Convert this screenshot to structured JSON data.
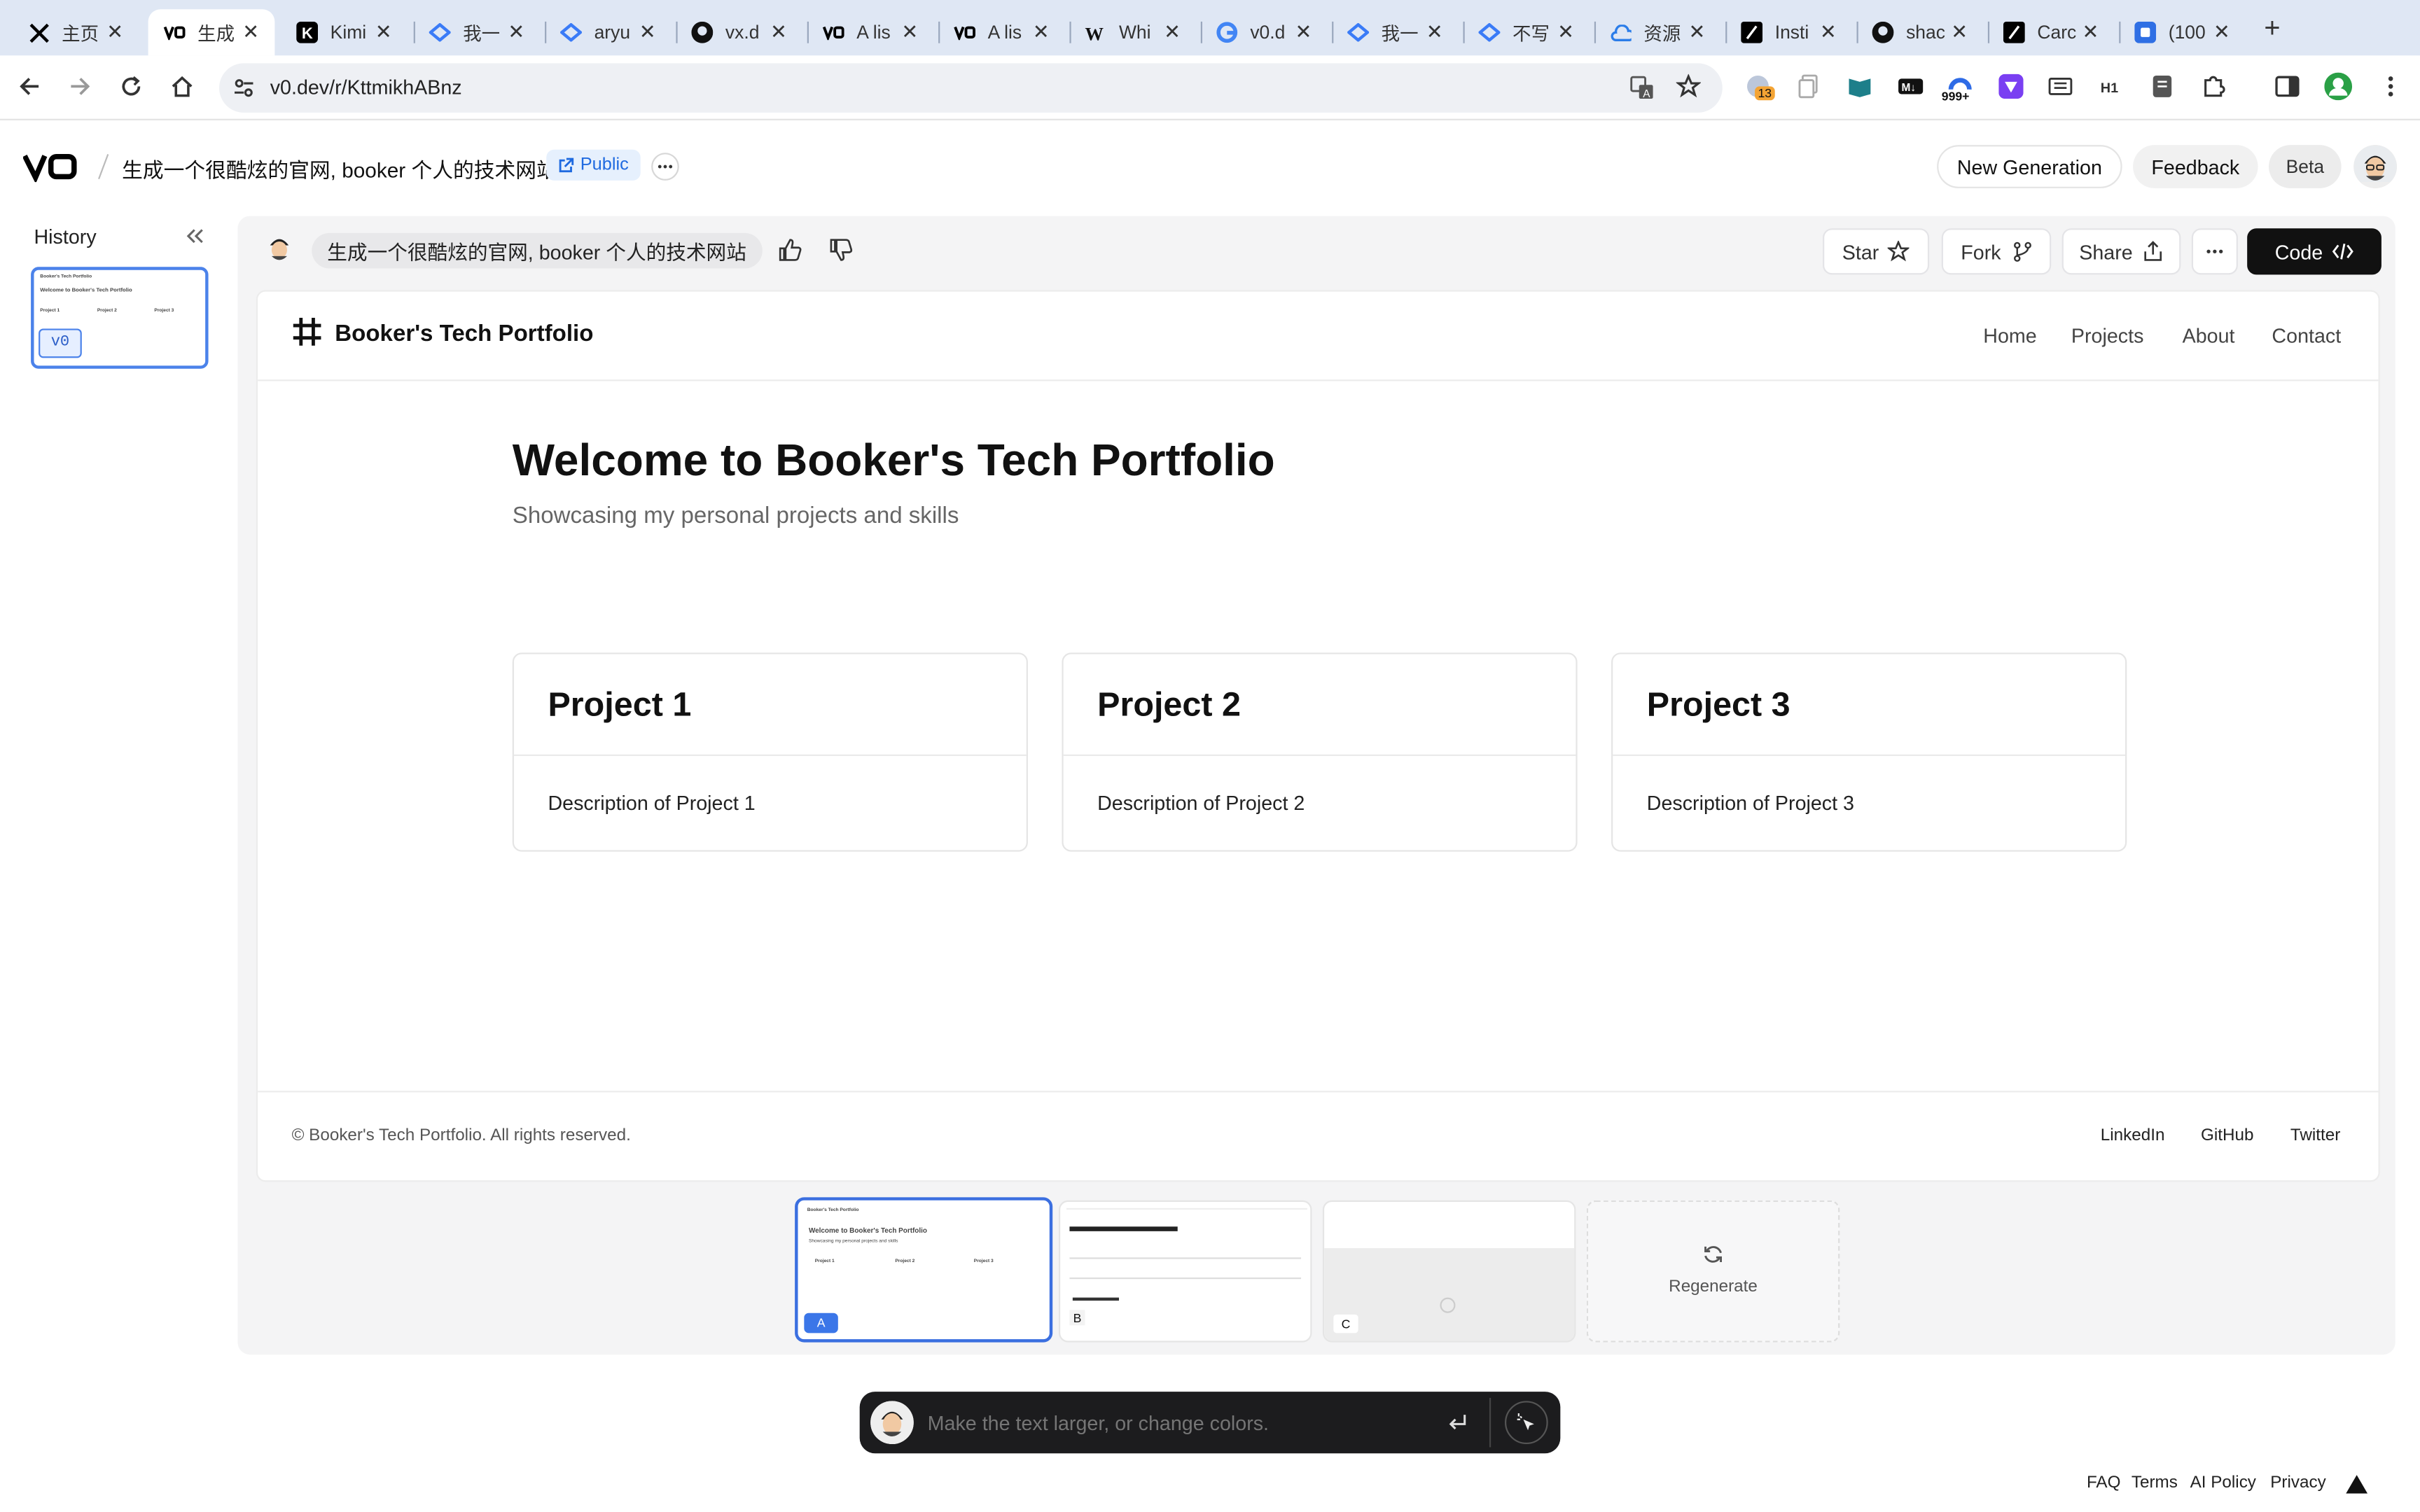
{
  "browser": {
    "tabs": [
      {
        "title": "主页",
        "icon": "x-logo-icon"
      },
      {
        "title": "生成",
        "icon": "v0-logo-icon",
        "active": true
      },
      {
        "title": "Kimi",
        "icon": "kimi-logo-icon"
      },
      {
        "title": "我一",
        "icon": "doc-logo-icon"
      },
      {
        "title": "aryu",
        "icon": "doc-logo-icon"
      },
      {
        "title": "vx.d",
        "icon": "github-icon"
      },
      {
        "title": "A lis",
        "icon": "v0-logo-icon"
      },
      {
        "title": "A lis",
        "icon": "v0-logo-icon"
      },
      {
        "title": "Whi",
        "icon": "w-logo-icon"
      },
      {
        "title": "v0.d",
        "icon": "google-icon"
      },
      {
        "title": "我一",
        "icon": "doc-logo-icon"
      },
      {
        "title": "不写",
        "icon": "doc-logo-icon"
      },
      {
        "title": "资源",
        "icon": "cloud-icon"
      },
      {
        "title": "Insti",
        "icon": "slash-logo-icon"
      },
      {
        "title": "shac",
        "icon": "github-icon"
      },
      {
        "title": "Carc",
        "icon": "slash-logo-icon"
      },
      {
        "title": "(100",
        "icon": "square-logo-icon"
      }
    ],
    "url": "v0.dev/r/KttmikhABnz",
    "badge_13": "13",
    "badge_999": "999+"
  },
  "header": {
    "title": "生成一个很酷炫的官网, booker 个人的技术网站",
    "visibility": "Public",
    "new_generation": "New Generation",
    "feedback": "Feedback",
    "beta": "Beta"
  },
  "sidebar": {
    "title": "History",
    "version": "v0"
  },
  "chat": {
    "prompt": "生成一个很酷炫的官网, booker 个人的技术网站",
    "star": "Star",
    "fork": "Fork",
    "share": "Share",
    "code": "Code"
  },
  "preview": {
    "brand": "Booker's Tech Portfolio",
    "nav": [
      "Home",
      "Projects",
      "About",
      "Contact"
    ],
    "heading": "Welcome to Booker's Tech Portfolio",
    "subheading": "Showcasing my personal projects and skills",
    "projects": [
      {
        "title": "Project 1",
        "desc": "Description of Project 1"
      },
      {
        "title": "Project 2",
        "desc": "Description of Project 2"
      },
      {
        "title": "Project 3",
        "desc": "Description of Project 3"
      }
    ],
    "copyright": "© Booker's Tech Portfolio. All rights reserved.",
    "social": [
      "LinkedIn",
      "GitHub",
      "Twitter"
    ]
  },
  "variants": {
    "a": "A",
    "b": "B",
    "c": "C",
    "regenerate": "Regenerate"
  },
  "input": {
    "placeholder": "Make the text larger, or change colors."
  },
  "footer": {
    "links": [
      "FAQ",
      "Terms",
      "AI Policy",
      "Privacy"
    ]
  }
}
